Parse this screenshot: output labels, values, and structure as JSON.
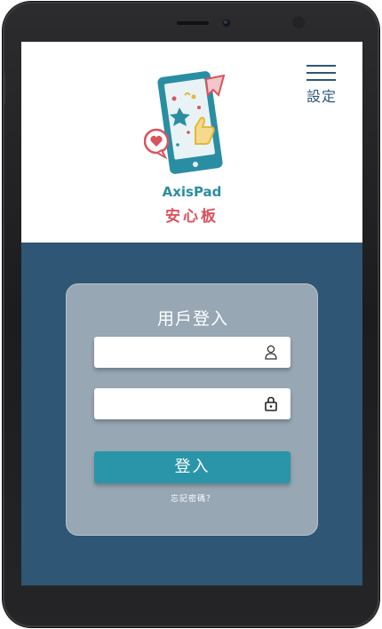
{
  "header": {
    "menu_label": "設定",
    "brand_name": "AxisPad",
    "brand_subtitle": "安心板"
  },
  "login": {
    "title": "用戶登入",
    "username_placeholder": "",
    "password_placeholder": "",
    "submit_label": "登入",
    "forgot_label": "忘記密碼？"
  },
  "colors": {
    "primary": "#2f5674",
    "accent": "#2a95a8",
    "brand_red": "#d9535f",
    "card": "#97a7b4"
  },
  "icons": {
    "user_field": "user-icon",
    "password_field": "lock-icon",
    "menu": "hamburger-icon"
  }
}
